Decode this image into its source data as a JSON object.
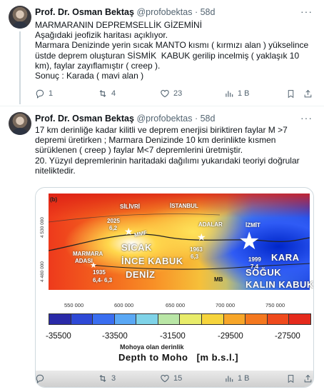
{
  "tweets": [
    {
      "name": "Prof. Dr. Osman Bektaş",
      "handle": "@profobektas",
      "dot": "·",
      "time": "58d",
      "text": "MARMARANIN DEPREMSELLİK GİZEMİNİ\nAşağıdaki jeofizik haritası açıklıyor.\nMarmara Denizinde yerin sıcak MANTO kısmı ( kırmızı alan ) yükselince üstde deprem oluşturan SİSMİK  KABUK gerilip incelmiş ( yaklaşık 10 km), faylar zayıflamıştır ( creep ).\nSonuç : Karada ( mavi alan )",
      "replies": "1",
      "retweets": "4",
      "likes": "23",
      "views": "1 B"
    },
    {
      "name": "Prof. Dr. Osman Bektaş",
      "handle": "@profobektas",
      "dot": "·",
      "time": "58d",
      "text": "17 km derinliğe kadar kilitli ve deprem enerjisi biriktiren faylar M >7 depremi üretirken ; Marmara Denizinde 10 km derinlikte kısmen sürüklenen ( creep ) faylar M<7 depremlerini üretmiştir.\n20. Yüzyıl depremlerinin haritadaki dağılımı yukarıdaki teoriyi doğrular niteliktedir.",
      "replies": "",
      "retweets": "3",
      "likes": "15",
      "views": "1 B"
    }
  ],
  "more_icon": "···",
  "map": {
    "panel": "(b)",
    "labels": {
      "silivri": "SİLİVRİ",
      "istanbul": "İSTANBUL",
      "year2025": "2025",
      "mag2025": "6,2",
      "mmf": "MMF",
      "adalar": "ADALAR",
      "izmit": "İZMİT",
      "marmara": "MARMARA",
      "adasi": "ADASI",
      "sicak": "SICAK",
      "ince": "İNCE KABUK",
      "deniz": "DENİZ",
      "year1963": "1963",
      "mag1963": "6,3",
      "year1935": "1935",
      "mag1935": "6,4- 6,3",
      "year1999": "1999",
      "mag1999": "7,4",
      "kara": "KARA",
      "soguk": "SOĞUK",
      "kalin": "KALIN KABUK",
      "mb": "MB"
    },
    "y_ticks": [
      "4 530 000",
      "4 480 000"
    ],
    "x_ticks": [
      "550 000",
      "600 000",
      "650 000",
      "700 000",
      "750 000"
    ],
    "colorbar_ticks": [
      "-35500",
      "-33500",
      "-31500",
      "-29500",
      "-27500"
    ],
    "colorbar_colors": [
      "#2a2aa8",
      "#2e49d6",
      "#3a6ef0",
      "#5aa8f5",
      "#7fd3e8",
      "#b9e6a6",
      "#e8ec6a",
      "#f6d43c",
      "#f7a629",
      "#f4781f",
      "#ef4a1d",
      "#e52a1c"
    ],
    "unit_tr": "Mohoya olan derinlik",
    "unit_en": "Depth to Moho",
    "unit_suffix": "[m b.s.l.]"
  }
}
